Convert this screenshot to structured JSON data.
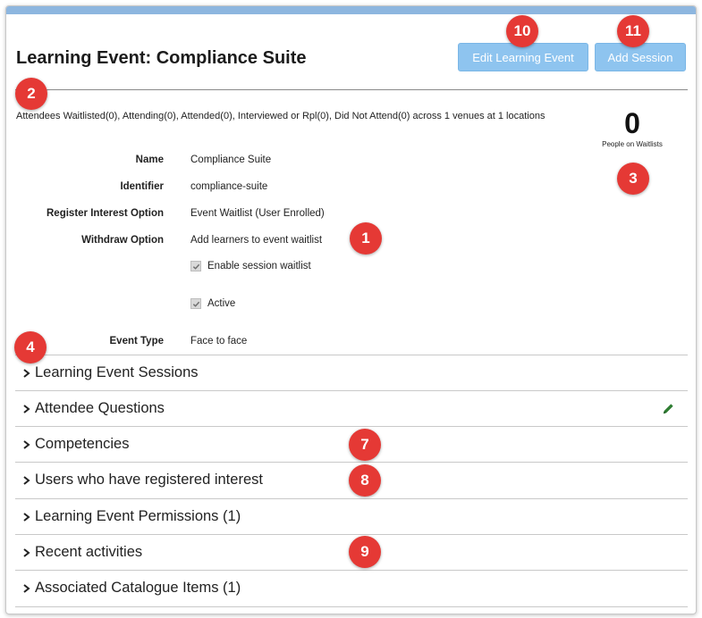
{
  "header": {
    "title": "Learning Event: Compliance Suite",
    "edit_button": "Edit Learning Event",
    "add_button": "Add Session"
  },
  "summary": "Attendees Waitlisted(0), Attending(0), Attended(0), Interviewed or Rpl(0), Did Not Attend(0) across 1 venues at 1 locations",
  "waitlist": {
    "count": "0",
    "label": "People on Waitlists"
  },
  "details": {
    "name_label": "Name",
    "name_value": "Compliance Suite",
    "identifier_label": "Identifier",
    "identifier_value": "compliance-suite",
    "register_label": "Register Interest Option",
    "register_value": "Event Waitlist (User Enrolled)",
    "withdraw_label": "Withdraw Option",
    "withdraw_value": "Add learners to event waitlist",
    "enable_waitlist_label": "Enable session waitlist",
    "active_label": "Active",
    "event_type_label": "Event Type",
    "event_type_value": "Face to face"
  },
  "sections": [
    "Learning Event Sessions",
    "Attendee Questions",
    "Competencies",
    "Users who have registered interest",
    "Learning Event Permissions (1)",
    "Recent activities",
    "Associated Catalogue Items (1)"
  ],
  "callouts": [
    "1",
    "2",
    "3",
    "4",
    "7",
    "8",
    "9",
    "10",
    "11"
  ],
  "colors": {
    "accent": "#8ec4ef",
    "callout": "#e53935",
    "topbar": "#8db6df"
  },
  "icons": {
    "section_toggle": "chevron-right-icon",
    "edit": "pencil-icon",
    "checkbox": "check-icon"
  }
}
